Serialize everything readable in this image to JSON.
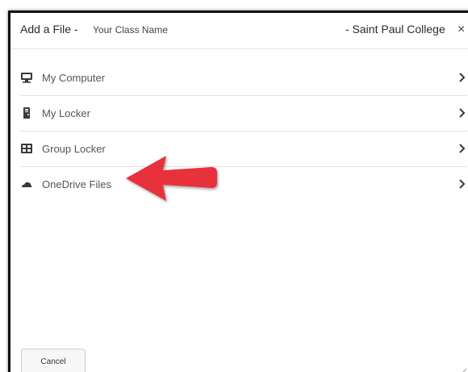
{
  "dialog": {
    "title_prefix": "Add a File -",
    "class_name": "Your Class Name",
    "college": "- Saint Paul College",
    "close_glyph": "×",
    "close_icon": "close-icon"
  },
  "menu": {
    "items": [
      {
        "label": "My Computer",
        "icon": "computer-icon",
        "chevron": "chevron-right-icon"
      },
      {
        "label": "My Locker",
        "icon": "locker-icon",
        "chevron": "chevron-right-icon"
      },
      {
        "label": "Group Locker",
        "icon": "group-locker-icon",
        "chevron": "chevron-right-icon"
      },
      {
        "label": "OneDrive Files",
        "icon": "cloud-icon",
        "chevron": "chevron-right-icon"
      }
    ]
  },
  "footer": {
    "cancel_label": "Cancel"
  },
  "annotation": {
    "icon": "red-arrow-icon",
    "color": "#e8323a"
  },
  "colors": {
    "border": "#111111",
    "divider": "#e2e2e2",
    "text": "#2b2b2b",
    "item_text": "#555555"
  }
}
